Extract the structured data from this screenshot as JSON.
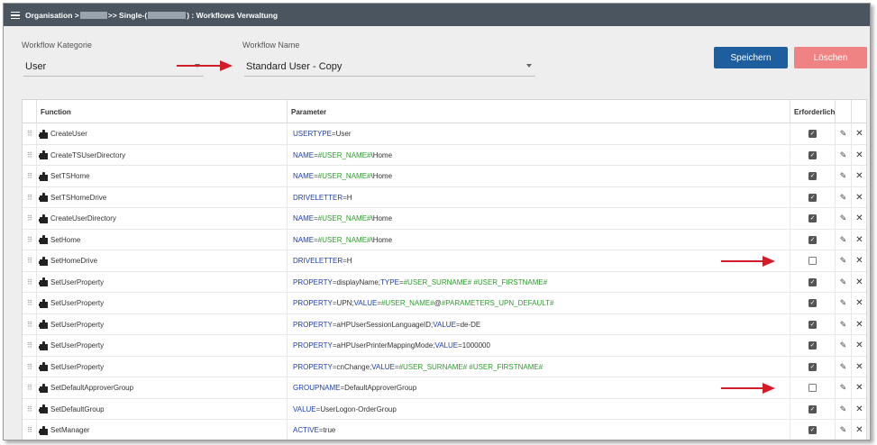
{
  "titlebar": {
    "prefix": "Organisation > ",
    "middle": " >> Single-(",
    "suffix": ") : Workflows Verwaltung"
  },
  "form": {
    "category_label": "Workflow Kategorie",
    "category_value": "User",
    "name_label": "Workflow Name",
    "name_value": "Standard User - Copy"
  },
  "buttons": {
    "save": "Speichern",
    "delete": "Löschen"
  },
  "colors": {
    "save": "#1f5e9e",
    "delete": "#ef8383",
    "titlebar": "#4a5560",
    "arrow": "#d11c2a"
  },
  "grid": {
    "headers": {
      "function": "Function",
      "parameter": "Parameter",
      "required": "Erforderlich"
    },
    "rows": [
      {
        "function": "CreateUser",
        "param": [
          [
            "k",
            "USERTYPE"
          ],
          [
            "op",
            "="
          ],
          [
            "v",
            "User"
          ]
        ],
        "required": true
      },
      {
        "function": "CreateTSUserDirectory",
        "param": [
          [
            "k",
            "NAME"
          ],
          [
            "op",
            "="
          ],
          [
            "t",
            "#USER_NAME#"
          ],
          [
            "v",
            "\\Home"
          ]
        ],
        "required": true
      },
      {
        "function": "SetTSHome",
        "param": [
          [
            "k",
            "NAME"
          ],
          [
            "op",
            "="
          ],
          [
            "t",
            "#USER_NAME#"
          ],
          [
            "v",
            "\\Home"
          ]
        ],
        "required": true
      },
      {
        "function": "SetTSHomeDrive",
        "param": [
          [
            "k",
            "DRIVELETTER"
          ],
          [
            "op",
            "="
          ],
          [
            "v",
            "H"
          ]
        ],
        "required": true
      },
      {
        "function": "CreateUserDirectory",
        "param": [
          [
            "k",
            "NAME"
          ],
          [
            "op",
            "="
          ],
          [
            "t",
            "#USER_NAME#"
          ],
          [
            "v",
            "\\Home"
          ]
        ],
        "required": true
      },
      {
        "function": "SetHome",
        "param": [
          [
            "k",
            "NAME"
          ],
          [
            "op",
            "="
          ],
          [
            "t",
            "#USER_NAME#"
          ],
          [
            "v",
            "\\Home"
          ]
        ],
        "required": true
      },
      {
        "function": "SetHomeDrive",
        "param": [
          [
            "k",
            "DRIVELETTER"
          ],
          [
            "op",
            "="
          ],
          [
            "v",
            "H"
          ]
        ],
        "required": false
      },
      {
        "function": "SetUserProperty",
        "param": [
          [
            "k",
            "PROPERTY"
          ],
          [
            "op",
            "="
          ],
          [
            "v",
            "displayName;"
          ],
          [
            "k",
            "TYPE"
          ],
          [
            "op",
            "="
          ],
          [
            "t",
            "#USER_SURNAME# #USER_FIRSTNAME#"
          ]
        ],
        "required": true
      },
      {
        "function": "SetUserProperty",
        "param": [
          [
            "k",
            "PROPERTY"
          ],
          [
            "op",
            "="
          ],
          [
            "v",
            "UPN;"
          ],
          [
            "k",
            "VALUE"
          ],
          [
            "op",
            "="
          ],
          [
            "t",
            "#USER_NAME#"
          ],
          [
            "v",
            "@"
          ],
          [
            "t",
            "#PARAMETERS_UPN_DEFAULT#"
          ]
        ],
        "required": true
      },
      {
        "function": "SetUserProperty",
        "param": [
          [
            "k",
            "PROPERTY"
          ],
          [
            "op",
            "="
          ],
          [
            "v",
            "aHPUserSessionLanguageID;"
          ],
          [
            "k",
            "VALUE"
          ],
          [
            "op",
            "="
          ],
          [
            "v",
            "de-DE"
          ]
        ],
        "required": true
      },
      {
        "function": "SetUserProperty",
        "param": [
          [
            "k",
            "PROPERTY"
          ],
          [
            "op",
            "="
          ],
          [
            "v",
            "aHPUserPrinterMappingMode;"
          ],
          [
            "k",
            "VALUE"
          ],
          [
            "op",
            "="
          ],
          [
            "v",
            "1000000"
          ]
        ],
        "required": true
      },
      {
        "function": "SetUserProperty",
        "param": [
          [
            "k",
            "PROPERTY"
          ],
          [
            "op",
            "="
          ],
          [
            "v",
            "cnChange;"
          ],
          [
            "k",
            "VALUE"
          ],
          [
            "op",
            "="
          ],
          [
            "t",
            "#USER_SURNAME# #USER_FIRSTNAME#"
          ]
        ],
        "required": true
      },
      {
        "function": "SetDefaultApproverGroup",
        "param": [
          [
            "k",
            "GROUPNAME"
          ],
          [
            "op",
            "="
          ],
          [
            "v",
            "DefaultApproverGroup"
          ]
        ],
        "required": false
      },
      {
        "function": "SetDefaultGroup",
        "param": [
          [
            "k",
            "VALUE"
          ],
          [
            "op",
            "="
          ],
          [
            "v",
            "UserLogon-OrderGroup"
          ]
        ],
        "required": true
      },
      {
        "function": "SetManager",
        "param": [
          [
            "k",
            "ACTIVE"
          ],
          [
            "op",
            "="
          ],
          [
            "v",
            "true"
          ]
        ],
        "required": true
      }
    ]
  }
}
